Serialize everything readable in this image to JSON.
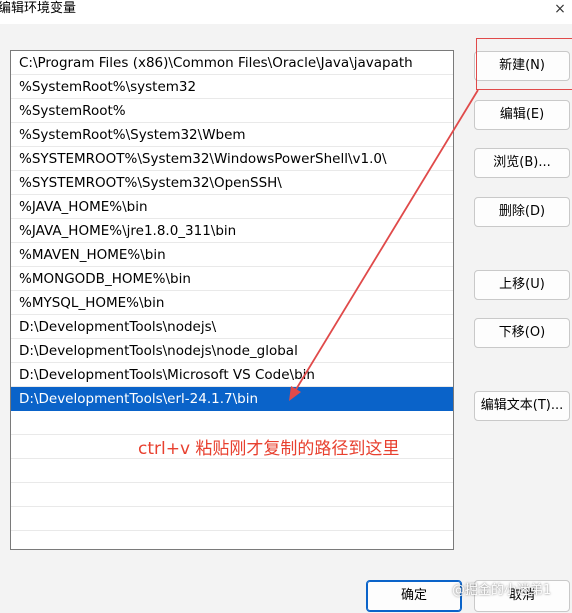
{
  "window": {
    "title": "编辑环境变量",
    "close_glyph": "×"
  },
  "path_list": [
    "C:\\Program Files (x86)\\Common Files\\Oracle\\Java\\javapath",
    "%SystemRoot%\\system32",
    "%SystemRoot%",
    "%SystemRoot%\\System32\\Wbem",
    "%SYSTEMROOT%\\System32\\WindowsPowerShell\\v1.0\\",
    "%SYSTEMROOT%\\System32\\OpenSSH\\",
    "%JAVA_HOME%\\bin",
    "%JAVA_HOME%\\jre1.8.0_311\\bin",
    "%MAVEN_HOME%\\bin",
    "%MONGODB_HOME%\\bin",
    "%MYSQL_HOME%\\bin",
    "D:\\DevelopmentTools\\nodejs\\",
    "D:\\DevelopmentTools\\nodejs\\node_global",
    "D:\\DevelopmentTools\\Microsoft VS Code\\bin",
    "D:\\DevelopmentTools\\erl-24.1.7\\bin"
  ],
  "selected_index": 14,
  "buttons": {
    "new": "新建(N)",
    "edit": "编辑(E)",
    "browse": "浏览(B)...",
    "delete": "删除(D)",
    "move_up": "上移(U)",
    "move_down": "下移(O)",
    "edit_text": "编辑文本(T)...",
    "ok": "确定",
    "cancel": "取消"
  },
  "annotation": {
    "text": "ctrl+v 粘贴刚才复制的路径到这里",
    "color": "#e8402f"
  },
  "watermark": "@掘金的小迷弟1",
  "colors": {
    "selection": "#0a63c9",
    "annotation": "#e04a4a"
  }
}
